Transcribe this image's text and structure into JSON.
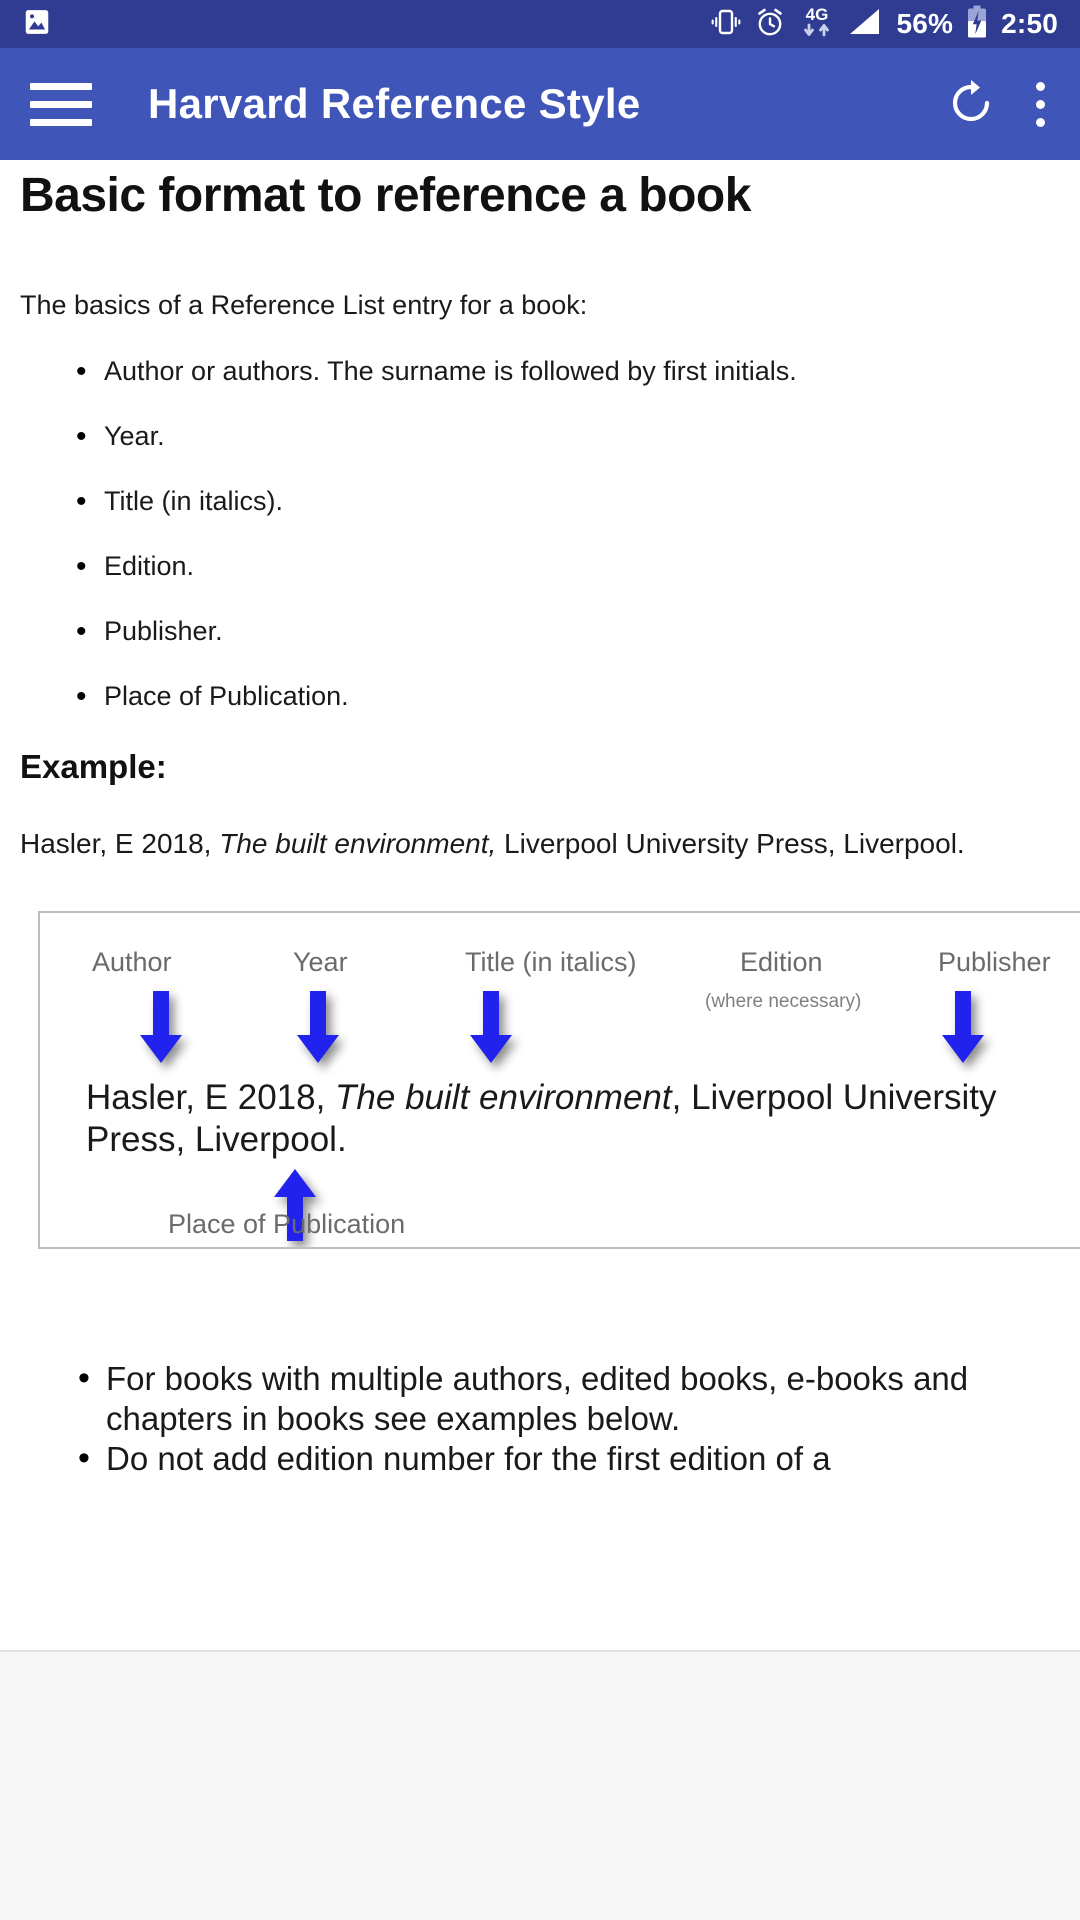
{
  "status_bar": {
    "icons": [
      "image-icon",
      "vibrate-icon",
      "alarm-icon",
      "network-4g-icon",
      "signal-icon",
      "battery-charging-icon"
    ],
    "network_label": "4G",
    "battery_percent": "56%",
    "time": "2:50"
  },
  "app_bar": {
    "title": "Harvard Reference Style",
    "menu_icon": "hamburger-menu-icon",
    "refresh_icon": "refresh-icon",
    "overflow_icon": "overflow-menu-icon"
  },
  "page": {
    "heading": "Basic format to reference a book",
    "intro": "The basics of a Reference List entry for a book:",
    "elements": [
      "Author or authors. The surname is followed by first initials.",
      "Year.",
      "Title (in italics).",
      "Edition.",
      "Publisher.",
      "Place of Publication."
    ],
    "example_heading": "Example:",
    "example_reference": {
      "before_italic": "Hasler, E 2018, ",
      "italic": "The built environment,",
      "after_italic": " Liverpool University Press, Liverpool."
    },
    "figure": {
      "labels": [
        {
          "text": "Author"
        },
        {
          "text": "Year"
        },
        {
          "text": "Title (in italics)"
        },
        {
          "text": "Edition"
        },
        {
          "text": "Publisher"
        }
      ],
      "edition_note": "(where necessary)",
      "bottom_label": "Place of Publication",
      "reference_line1_before_italic": "Hasler, E 2018, ",
      "reference_line1_italic": "The built environment",
      "reference_line1_after_italic": ", Liverpool University",
      "reference_line2": "Press, Liverpool.",
      "arrow_color": "#2222ee"
    },
    "notes": [
      "For books with multiple authors, edited books, e-books and chapters in books see examples below.",
      "Do not add edition number for the first edition of a"
    ]
  },
  "colors": {
    "status_bar_bg": "#2f3c91",
    "app_bar_bg": "#4055b8",
    "content_bg": "#ffffff",
    "bottom_pane_bg": "#f7f7f7"
  }
}
